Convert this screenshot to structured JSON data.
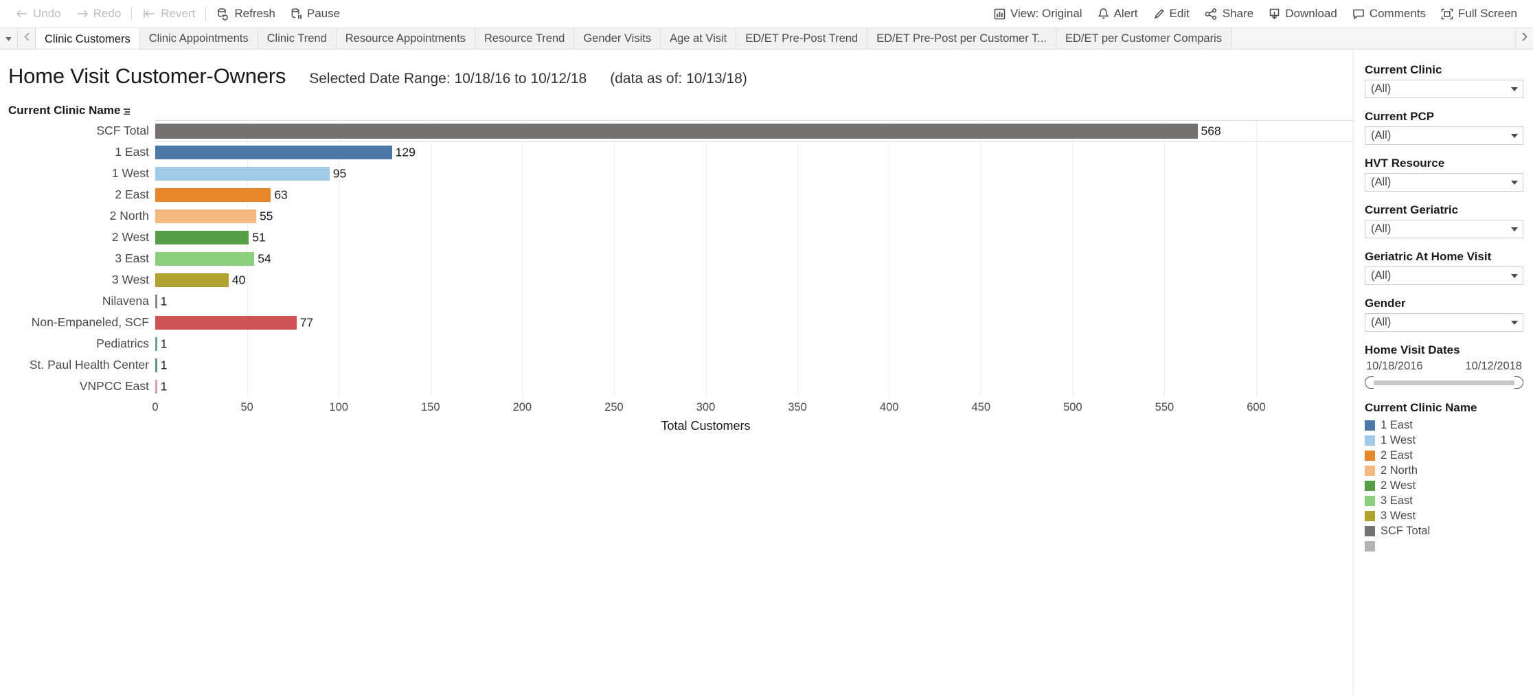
{
  "toolbar": {
    "left": [
      {
        "label": "Undo",
        "icon": "undo-icon",
        "disabled": true
      },
      {
        "label": "Redo",
        "icon": "redo-icon",
        "disabled": true
      },
      {
        "label": "Revert",
        "icon": "revert-icon",
        "disabled": true
      },
      {
        "label": "Refresh",
        "icon": "refresh-icon",
        "disabled": false
      },
      {
        "label": "Pause",
        "icon": "pause-icon",
        "disabled": false
      }
    ],
    "right": [
      {
        "label": "View: Original",
        "icon": "view-icon"
      },
      {
        "label": "Alert",
        "icon": "bell-icon"
      },
      {
        "label": "Edit",
        "icon": "pencil-icon"
      },
      {
        "label": "Share",
        "icon": "share-icon"
      },
      {
        "label": "Download",
        "icon": "download-icon"
      },
      {
        "label": "Comments",
        "icon": "comment-icon"
      },
      {
        "label": "Full Screen",
        "icon": "fullscreen-icon"
      }
    ]
  },
  "tabs": {
    "active_index": 0,
    "items": [
      "Clinic Customers",
      "Clinic Appointments",
      "Clinic Trend",
      "Resource Appointments",
      "Resource Trend",
      "Gender Visits",
      "Age at Visit",
      "ED/ET Pre-Post Trend",
      "ED/ET Pre-Post per Customer T...",
      "ED/ET per Customer Comparis"
    ]
  },
  "header": {
    "title": "Home Visit Customer-Owners",
    "date_range": "Selected Date Range: 10/18/16 to 10/12/18",
    "as_of": "(data as of: 10/13/18)"
  },
  "chart_data": {
    "type": "bar",
    "orientation": "horizontal",
    "title": "Home Visit Customer-Owners",
    "row_header": "Current Clinic Name",
    "xlabel": "Total Customers",
    "ylabel": "",
    "xlim": [
      0,
      600
    ],
    "xticks": [
      0,
      50,
      100,
      150,
      200,
      250,
      300,
      350,
      400,
      450,
      500,
      550,
      600
    ],
    "grid": true,
    "categories": [
      "SCF Total",
      "1 East",
      "1 West",
      "2 East",
      "2 North",
      "2 West",
      "3 East",
      "3 West",
      "Nilavena",
      "Non-Empaneled, SCF",
      "Pediatrics",
      "St. Paul Health Center",
      "VNPCC East"
    ],
    "values": [
      568,
      129,
      95,
      63,
      55,
      51,
      54,
      40,
      1,
      77,
      1,
      1,
      1
    ],
    "colors": [
      "#767270",
      "#4e79a7",
      "#a0cbe8",
      "#e8862a",
      "#f5b97f",
      "#579e49",
      "#8ace7e",
      "#b2a230",
      "#7b8a8b",
      "#cf5457",
      "#6f9e9a",
      "#5f9190",
      "#d9a0a5"
    ],
    "total_row_index": 0
  },
  "sidebar": {
    "filters": [
      {
        "label": "Current Clinic",
        "value": "(All)"
      },
      {
        "label": "Current PCP",
        "value": "(All)"
      },
      {
        "label": "HVT Resource",
        "value": "(All)"
      },
      {
        "label": "Current Geriatric",
        "value": "(All)"
      },
      {
        "label": "Geriatric At Home Visit",
        "value": "(All)"
      },
      {
        "label": "Gender",
        "value": "(All)"
      }
    ],
    "date_filter": {
      "label": "Home Visit Dates",
      "start": "10/18/2016",
      "end": "10/12/2018"
    },
    "legend": {
      "title": "Current Clinic Name",
      "items": [
        {
          "label": "1 East",
          "color": "#4e79a7"
        },
        {
          "label": "1 West",
          "color": "#a0cbe8"
        },
        {
          "label": "2 East",
          "color": "#e8862a"
        },
        {
          "label": "2 North",
          "color": "#f5b97f"
        },
        {
          "label": "2 West",
          "color": "#579e49"
        },
        {
          "label": "3 East",
          "color": "#8ace7e"
        },
        {
          "label": "3 West",
          "color": "#b2a230"
        },
        {
          "label": "SCF Total",
          "color": "#767270"
        },
        {
          "label": "",
          "color": "#b3b3b3"
        }
      ]
    }
  }
}
